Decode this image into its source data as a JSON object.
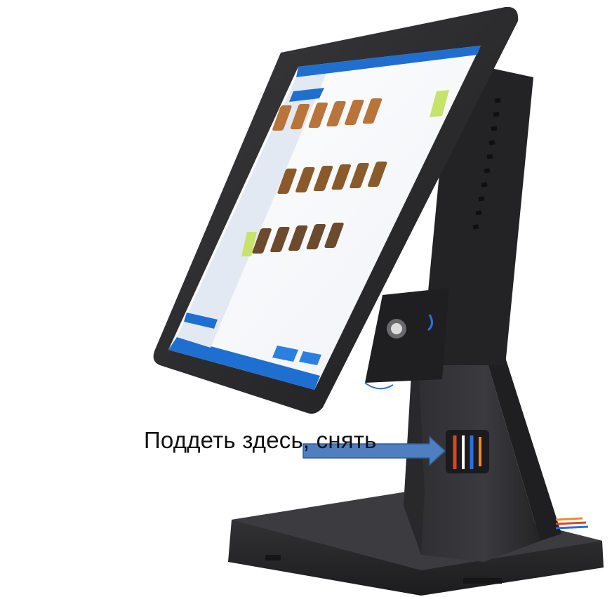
{
  "caption": "Поддеть здесь, снять",
  "colors": {
    "device_body": "#2a2a2c",
    "device_edge": "#1b1b1d",
    "screen_accent": "#1f6fd1",
    "arrow_fill": "#4f7fc0",
    "arrow_stroke": "#2f5f9c",
    "cable_red": "#d9452b",
    "cable_blue": "#2b6fe0",
    "cable_orange": "#f08a2a"
  },
  "icons": {
    "arrow": "right-arrow-icon",
    "button": "power-button-icon"
  }
}
